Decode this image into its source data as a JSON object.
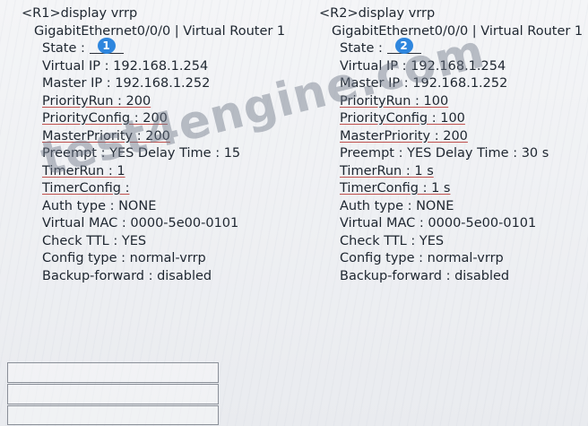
{
  "r1": {
    "command": "<R1>display vrrp",
    "interface_line": "GigabitEthernet0/0/0 | Virtual Router 1",
    "state_label": "State :",
    "state_marker": "1",
    "virtual_ip": "Virtual IP : 192.168.1.254",
    "master_ip": "Master IP : 192.168.1.252",
    "priority_run": "PriorityRun : 200",
    "priority_config": "PriorityConfig : 200",
    "master_priority": "MasterPriority : 200",
    "preempt": "Preempt : YES   Delay Time : 15",
    "timer_run": "TimerRun : 1",
    "timer_config": "TimerConfig :",
    "auth_type": "Auth type : NONE",
    "virtual_mac": "Virtual MAC : 0000-5e00-0101",
    "check_ttl": "Check TTL : YES",
    "config_type": "Config type : normal-vrrp",
    "backup_forward": "Backup-forward : disabled"
  },
  "r2": {
    "command": "<R2>display vrrp",
    "interface_line": "GigabitEthernet0/0/0 | Virtual Router 1",
    "state_label": "State :",
    "state_marker": "2",
    "virtual_ip": "Virtual IP : 192.168.1.254",
    "master_ip": "Master IP : 192.168.1.252",
    "priority_run": "PriorityRun : 100",
    "priority_config": "PriorityConfig : 100",
    "master_priority": "MasterPriority : 200",
    "preempt": "Preempt : YES   Delay Time : 30 s",
    "timer_run": "TimerRun : 1 s",
    "timer_config": "TimerConfig : 1 s",
    "auth_type": "Auth type : NONE",
    "virtual_mac": "Virtual MAC : 0000-5e00-0101",
    "check_ttl": "Check TTL : YES",
    "config_type": "Config type : normal-vrrp",
    "backup_forward": "Backup-forward : disabled"
  },
  "watermark": "test4engine.com",
  "colors": {
    "marker": "#2e86de",
    "underline": "#c0504d",
    "text": "#1e2630"
  }
}
